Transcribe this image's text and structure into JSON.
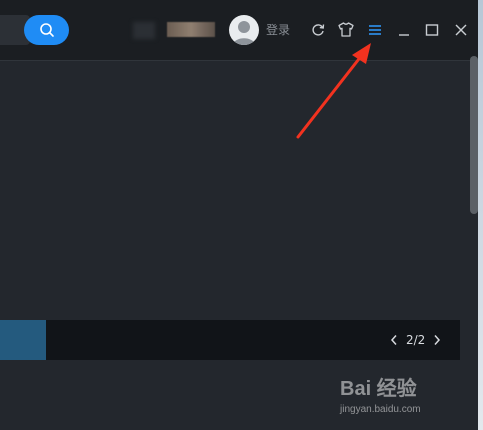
{
  "titlebar": {
    "login_label": "登录",
    "icons": [
      "search-icon",
      "avatar-icon",
      "refresh-icon",
      "skin-icon",
      "menu-icon",
      "minimize-icon",
      "maximize-icon",
      "close-icon"
    ]
  },
  "banner": {
    "pager_text": "2/2"
  },
  "watermark": {
    "logo_text": "Bai 经验",
    "url": "jingyan.baidu.com"
  },
  "colors": {
    "accent": "#1f8cf5",
    "background": "#23272d",
    "titlebar": "#1b1e22",
    "annotation_arrow": "#f2321f"
  }
}
